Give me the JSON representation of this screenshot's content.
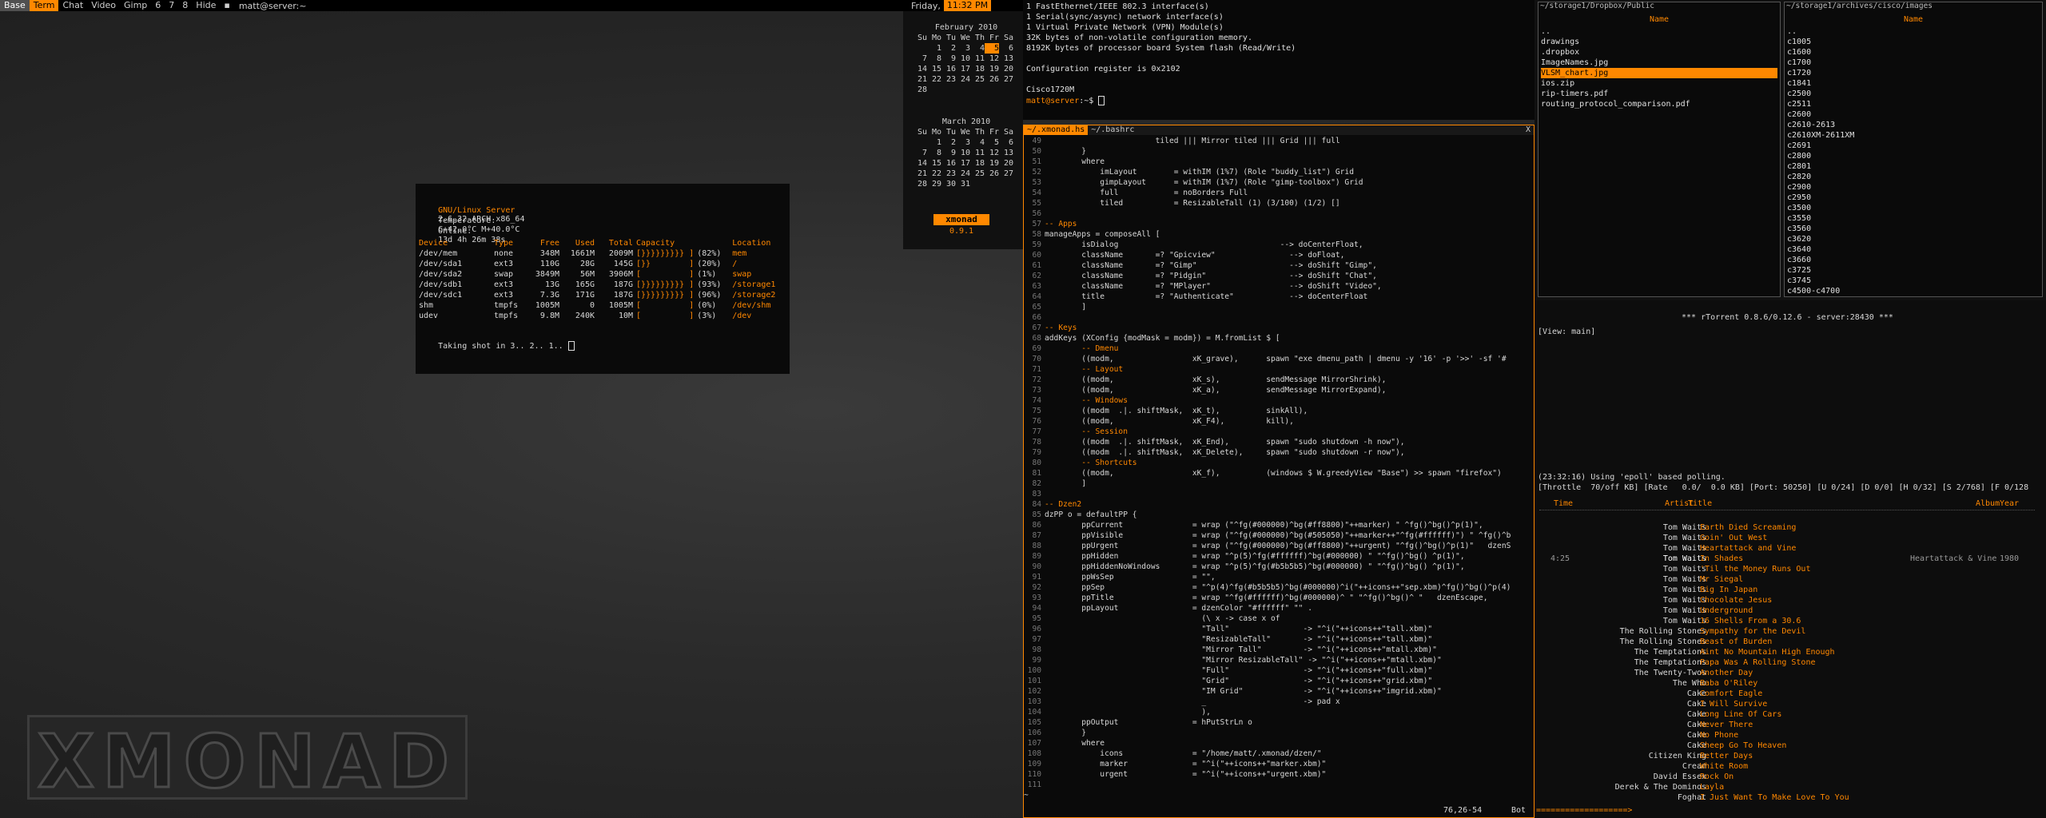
{
  "topbar": {
    "workspaces": [
      {
        "label": "Base",
        "state": "current"
      },
      {
        "label": "Term",
        "state": "visible"
      },
      {
        "label": "Chat",
        "state": "normal"
      },
      {
        "label": "Video",
        "state": "normal"
      },
      {
        "label": "Gimp",
        "state": "normal"
      },
      {
        "label": "6",
        "state": "normal"
      },
      {
        "label": "7",
        "state": "normal"
      },
      {
        "label": "8",
        "state": "normal"
      },
      {
        "label": "Hide",
        "state": "normal"
      }
    ],
    "layout_icon": "▪",
    "window_title": "matt@server:~",
    "day": "Friday,",
    "clock": "11:32 PM",
    "accent": "#ff8800"
  },
  "calendar": {
    "headers": [
      "Su",
      "Mo",
      "Tu",
      "We",
      "Th",
      "Fr",
      "Sa"
    ],
    "months": [
      {
        "name": "February 2010",
        "rows": [
          [
            "",
            "1",
            "2",
            "3",
            "4",
            "5",
            "6"
          ],
          [
            "7",
            "8",
            "9",
            "10",
            "11",
            "12",
            "13"
          ],
          [
            "14",
            "15",
            "16",
            "17",
            "18",
            "19",
            "20"
          ],
          [
            "21",
            "22",
            "23",
            "24",
            "25",
            "26",
            "27"
          ],
          [
            "28",
            "",
            "",
            "",
            "",
            "",
            ""
          ]
        ],
        "today": "5"
      },
      {
        "name": "March 2010",
        "rows": [
          [
            "",
            "1",
            "2",
            "3",
            "4",
            "5",
            "6"
          ],
          [
            "7",
            "8",
            "9",
            "10",
            "11",
            "12",
            "13"
          ],
          [
            "14",
            "15",
            "16",
            "17",
            "18",
            "19",
            "20"
          ],
          [
            "21",
            "22",
            "23",
            "24",
            "25",
            "26",
            "27"
          ],
          [
            "28",
            "29",
            "30",
            "31",
            "",
            "",
            ""
          ]
        ],
        "today": ""
      }
    ],
    "logo_text": "xmonad",
    "version": "0.9.1"
  },
  "diskterm": {
    "os_label": "GNU/Linux Server",
    "kernel": "2.6.32-ARCH x86_64",
    "temp_label": "Temperature:",
    "temp_value": "C+42.0°C M+40.0°C",
    "online_label": "Online:",
    "online_value": "13d 4h 26m 38s",
    "headers": [
      "Device",
      "Type",
      "Free",
      "Used",
      "Total",
      "Capacity",
      "",
      "Location"
    ],
    "rows": [
      [
        "/dev/mem",
        "none",
        "348M",
        "1661M",
        "2009M",
        "[}}}}}}}}} ]",
        "(82%)",
        "mem"
      ],
      [
        "/dev/sda1",
        "ext3",
        "110G",
        "28G",
        "145G",
        "[}}        ]",
        "(20%)",
        "/"
      ],
      [
        "/dev/sda2",
        "swap",
        "3849M",
        "56M",
        "3906M",
        "[          ]",
        "(1%)",
        "swap"
      ],
      [
        "/dev/sdb1",
        "ext3",
        "13G",
        "165G",
        "187G",
        "[}}}}}}}}} ]",
        "(93%)",
        "/storage1"
      ],
      [
        "/dev/sdc1",
        "ext3",
        "7.3G",
        "171G",
        "187G",
        "[}}}}}}}}} ]",
        "(96%)",
        "/storage2"
      ],
      [
        "shm",
        "tmpfs",
        "1005M",
        "0",
        "1005M",
        "[          ]",
        "(0%)",
        "/dev/shm"
      ],
      [
        "udev",
        "tmpfs",
        "9.8M",
        "240K",
        "10M",
        "[          ]",
        "(3%)",
        "/dev"
      ]
    ],
    "footer": "Taking shot in 3.. 2.. 1.. "
  },
  "biglogo": {
    "text": "XMONAD"
  },
  "cisco": {
    "lines": [
      "1 FastEthernet/IEEE 802.3 interface(s)",
      "1 Serial(sync/async) network interface(s)",
      "1 Virtual Private Network (VPN) Module(s)",
      "32K bytes of non-volatile configuration memory.",
      "8192K bytes of processor board System flash (Read/Write)",
      "",
      "Configuration register is 0x2102",
      "",
      "Cisco1720M"
    ],
    "prompt_user": "matt@server",
    "prompt_rest": ":~$ "
  },
  "vim": {
    "tabs": [
      "~/.xmonad.hs",
      "~/.bashrc"
    ],
    "close": "X",
    "lines": [
      [
        "49",
        "                        tiled ||| Mirror tiled ||| Grid ||| full"
      ],
      [
        "50",
        "        }"
      ],
      [
        "51",
        "        where"
      ],
      [
        "52",
        "            imLayout        = withIM (1%7) (Role \"buddy_list\") Grid"
      ],
      [
        "53",
        "            gimpLayout      = withIM (1%7) (Role \"gimp-toolbox\") Grid"
      ],
      [
        "54",
        "            full            = noBorders Full"
      ],
      [
        "55",
        "            tiled           = ResizableTall (1) (3/100) (1/2) []"
      ],
      [
        "56",
        ""
      ],
      [
        "57",
        "-- Apps"
      ],
      [
        "58",
        "manageApps = composeAll ["
      ],
      [
        "59",
        "        isDialog                                   --> doCenterFloat,"
      ],
      [
        "60",
        "        className       =? \"Gpicview\"                --> doFloat,"
      ],
      [
        "61",
        "        className       =? \"Gimp\"                    --> doShift \"Gimp\","
      ],
      [
        "62",
        "        className       =? \"Pidgin\"                  --> doShift \"Chat\","
      ],
      [
        "63",
        "        className       =? \"MPlayer\"                 --> doShift \"Video\","
      ],
      [
        "64",
        "        title           =? \"Authenticate\"            --> doCenterFloat"
      ],
      [
        "65",
        "        ]"
      ],
      [
        "66",
        ""
      ],
      [
        "67",
        "-- Keys"
      ],
      [
        "68",
        "addKeys (XConfig {modMask = modm}) = M.fromList $ ["
      ],
      [
        "69",
        "        -- Dmenu"
      ],
      [
        "70",
        "        ((modm,                 xK_grave),      spawn \"exe dmenu_path | dmenu -y '16' -p '>>' -sf '#"
      ],
      [
        "71",
        "        -- Layout"
      ],
      [
        "72",
        "        ((modm,                 xK_s),          sendMessage MirrorShrink),"
      ],
      [
        "73",
        "        ((modm,                 xK_a),          sendMessage MirrorExpand),"
      ],
      [
        "74",
        "        -- Windows"
      ],
      [
        "75",
        "        ((modm  .|. shiftMask,  xK_t),          sinkAll),"
      ],
      [
        "76",
        "        ((modm,                 xK_F4),         kill),"
      ],
      [
        "77",
        "        -- Session"
      ],
      [
        "78",
        "        ((modm  .|. shiftMask,  xK_End),        spawn \"sudo shutdown -h now\"),"
      ],
      [
        "79",
        "        ((modm  .|. shiftMask,  xK_Delete),     spawn \"sudo shutdown -r now\"),"
      ],
      [
        "80",
        "        -- Shortcuts"
      ],
      [
        "81",
        "        ((modm,                 xK_f),          (windows $ W.greedyView \"Base\") >> spawn \"firefox\")"
      ],
      [
        "82",
        "        ]"
      ],
      [
        "83",
        ""
      ],
      [
        "84",
        "-- Dzen2"
      ],
      [
        "85",
        "dzPP o = defaultPP {"
      ],
      [
        "86",
        "        ppCurrent               = wrap (\"^fg(#000000)^bg(#ff8800)\"++marker) \" ^fg()^bg()^p(1)\","
      ],
      [
        "87",
        "        ppVisible               = wrap (\"^fg(#000000)^bg(#505050)\"++marker++\"^fg(#ffffff)\") \" ^fg()^b"
      ],
      [
        "88",
        "        ppUrgent                = wrap (\"^fg(#000000)^bg(#ff8800)\"++urgent) \"^fg()^bg()^p(1)\"   dzenS"
      ],
      [
        "89",
        "        ppHidden                = wrap \"^p(5)^fg(#ffffff)^bg(#000000) \" \"^fg()^bg() ^p(1)\","
      ],
      [
        "90",
        "        ppHiddenNoWindows       = wrap \"^p(5)^fg(#b5b5b5)^bg(#000000) \" \"^fg()^bg() ^p(1)\","
      ],
      [
        "91",
        "        ppWsSep                 = \"\","
      ],
      [
        "92",
        "        ppSep                   = \"^p(4)^fg(#b5b5b5)^bg(#000000)^i(\"++icons++\"sep.xbm)^fg()^bg()^p(4)"
      ],
      [
        "93",
        "        ppTitle                 = wrap \"^fg(#ffffff)^bg(#000000)^ \" \"^fg()^bg()^ \"   dzenEscape,"
      ],
      [
        "94",
        "        ppLayout                = dzenColor \"#ffffff\" \"\" ."
      ],
      [
        "95",
        "                                  (\\ x -> case x of"
      ],
      [
        "96",
        "                                  \"Tall\"                -> \"^i(\"++icons++\"tall.xbm)\""
      ],
      [
        "97",
        "                                  \"ResizableTall\"       -> \"^i(\"++icons++\"tall.xbm)\""
      ],
      [
        "98",
        "                                  \"Mirror Tall\"         -> \"^i(\"++icons++\"mtall.xbm)\""
      ],
      [
        "99",
        "                                  \"Mirror ResizableTall\" -> \"^i(\"++icons++\"mtall.xbm)\""
      ],
      [
        "100",
        "                                  \"Full\"                -> \"^i(\"++icons++\"full.xbm)\""
      ],
      [
        "101",
        "                                  \"Grid\"                -> \"^i(\"++icons++\"grid.xbm)\""
      ],
      [
        "102",
        "                                  \"IM Grid\"             -> \"^i(\"++icons++\"imgrid.xbm)\""
      ],
      [
        "103",
        "                                  _                     -> pad x"
      ],
      [
        "104",
        "                                  ),"
      ],
      [
        "105",
        "        ppOutput                = hPutStrLn o"
      ],
      [
        "106",
        "        }"
      ],
      [
        "107",
        "        where"
      ],
      [
        "108",
        "            icons               = \"/home/matt/.xmonad/dzen/\""
      ],
      [
        "109",
        "            marker              = \"^i(\"++icons++\"marker.xbm)\""
      ],
      [
        "110",
        "            urgent              = \"^i(\"++icons++\"urgent.xbm)\""
      ],
      [
        "111",
        ""
      ]
    ],
    "tilde": "~",
    "position": "76,26-54",
    "percent": "Bot"
  },
  "filemanager": {
    "left": {
      "path": "~/storage1/Dropbox/Public",
      "header": "Name",
      "items": [
        "..",
        "drawings",
        ".dropbox",
        "ImageNames.jpg",
        "VLSM_chart.jpg",
        "ios.zip",
        "rip-timers.pdf",
        "routing_protocol_comparison.pdf"
      ],
      "selected": "VLSM_chart.jpg"
    },
    "right": {
      "path": "~/storage1/archives/cisco/images",
      "header": "Name",
      "items": [
        "..",
        "c1005",
        "c1600",
        "c1700",
        "c1720",
        "c1841",
        "c2500",
        "c2511",
        "c2600",
        "c2610-2613",
        "c2610XM-2611XM",
        "c2691",
        "c2800",
        "c2801",
        "c2820",
        "c2900",
        "c2950",
        "c3500",
        "c3550",
        "c3560",
        "c3620",
        "c3640",
        "c3660",
        "c3725",
        "c3745",
        "c4500-c4700"
      ]
    }
  },
  "rtorrent": {
    "title": "*** rTorrent 0.8.6/0.12.6 - server:28430 ***",
    "view": "[View: main]",
    "log": "(23:32:16) Using 'epoll' based polling.",
    "status": "[Throttle  70/off KB] [Rate   0.0/  0.0 KB] [Port: 50250] [U 0/24] [D 0/0] [H 0/32] [S 2/768] [F 0/128"
  },
  "music": {
    "headers": {
      "time": "Time",
      "artist": "Artist",
      "title": "Title",
      "album": "Album",
      "year": "Year"
    },
    "rows": [
      {
        "artist": "Tom Waits",
        "title": "Earth Died Screaming"
      },
      {
        "artist": "Tom Waits",
        "title": "Goin' Out West"
      },
      {
        "artist": "Tom Waits",
        "title": "Heartattack and Vine"
      },
      {
        "artist": "Tom Waits",
        "title": "In Shades",
        "time": "4:25",
        "album": "Heartattack & Vine",
        "year": "1980",
        "current": true
      },
      {
        "artist": "Tom Waits",
        "title": "'Til the Money Runs Out"
      },
      {
        "artist": "Tom Waits",
        "title": "Mr Siegal"
      },
      {
        "artist": "Tom Waits",
        "title": "Big In Japan"
      },
      {
        "artist": "Tom Waits",
        "title": "Chocolate Jesus"
      },
      {
        "artist": "Tom Waits",
        "title": "Underground"
      },
      {
        "artist": "Tom Waits",
        "title": "16 Shells From a 30.6"
      },
      {
        "artist": "The Rolling Stones",
        "title": "Sympathy for the Devil"
      },
      {
        "artist": "The Rolling Stones",
        "title": "Beast of Burden"
      },
      {
        "artist": "The Temptations",
        "title": "Aint No Mountain High Enough"
      },
      {
        "artist": "The Temptations",
        "title": "Papa Was A Rolling Stone"
      },
      {
        "artist": "The Twenty-Twos",
        "title": "Another Day"
      },
      {
        "artist": "The Who",
        "title": "Baba O'Riley"
      },
      {
        "artist": "Cake",
        "title": "Comfort Eagle"
      },
      {
        "artist": "Cake",
        "title": "I Will Survive"
      },
      {
        "artist": "Cake",
        "title": "Long Line Of Cars"
      },
      {
        "artist": "Cake",
        "title": "Never There"
      },
      {
        "artist": "Cake",
        "title": "No Phone"
      },
      {
        "artist": "Cake",
        "title": "Sheep Go To Heaven"
      },
      {
        "artist": "Citizen King",
        "title": "Better Days"
      },
      {
        "artist": "Cream",
        "title": "White Room"
      },
      {
        "artist": "David Essex",
        "title": "Rock On"
      },
      {
        "artist": "Derek & The Dominos",
        "title": "Layla"
      },
      {
        "artist": "Foghat",
        "title": "I Just Want To Make Love To You"
      }
    ],
    "bottom": "===================>"
  }
}
